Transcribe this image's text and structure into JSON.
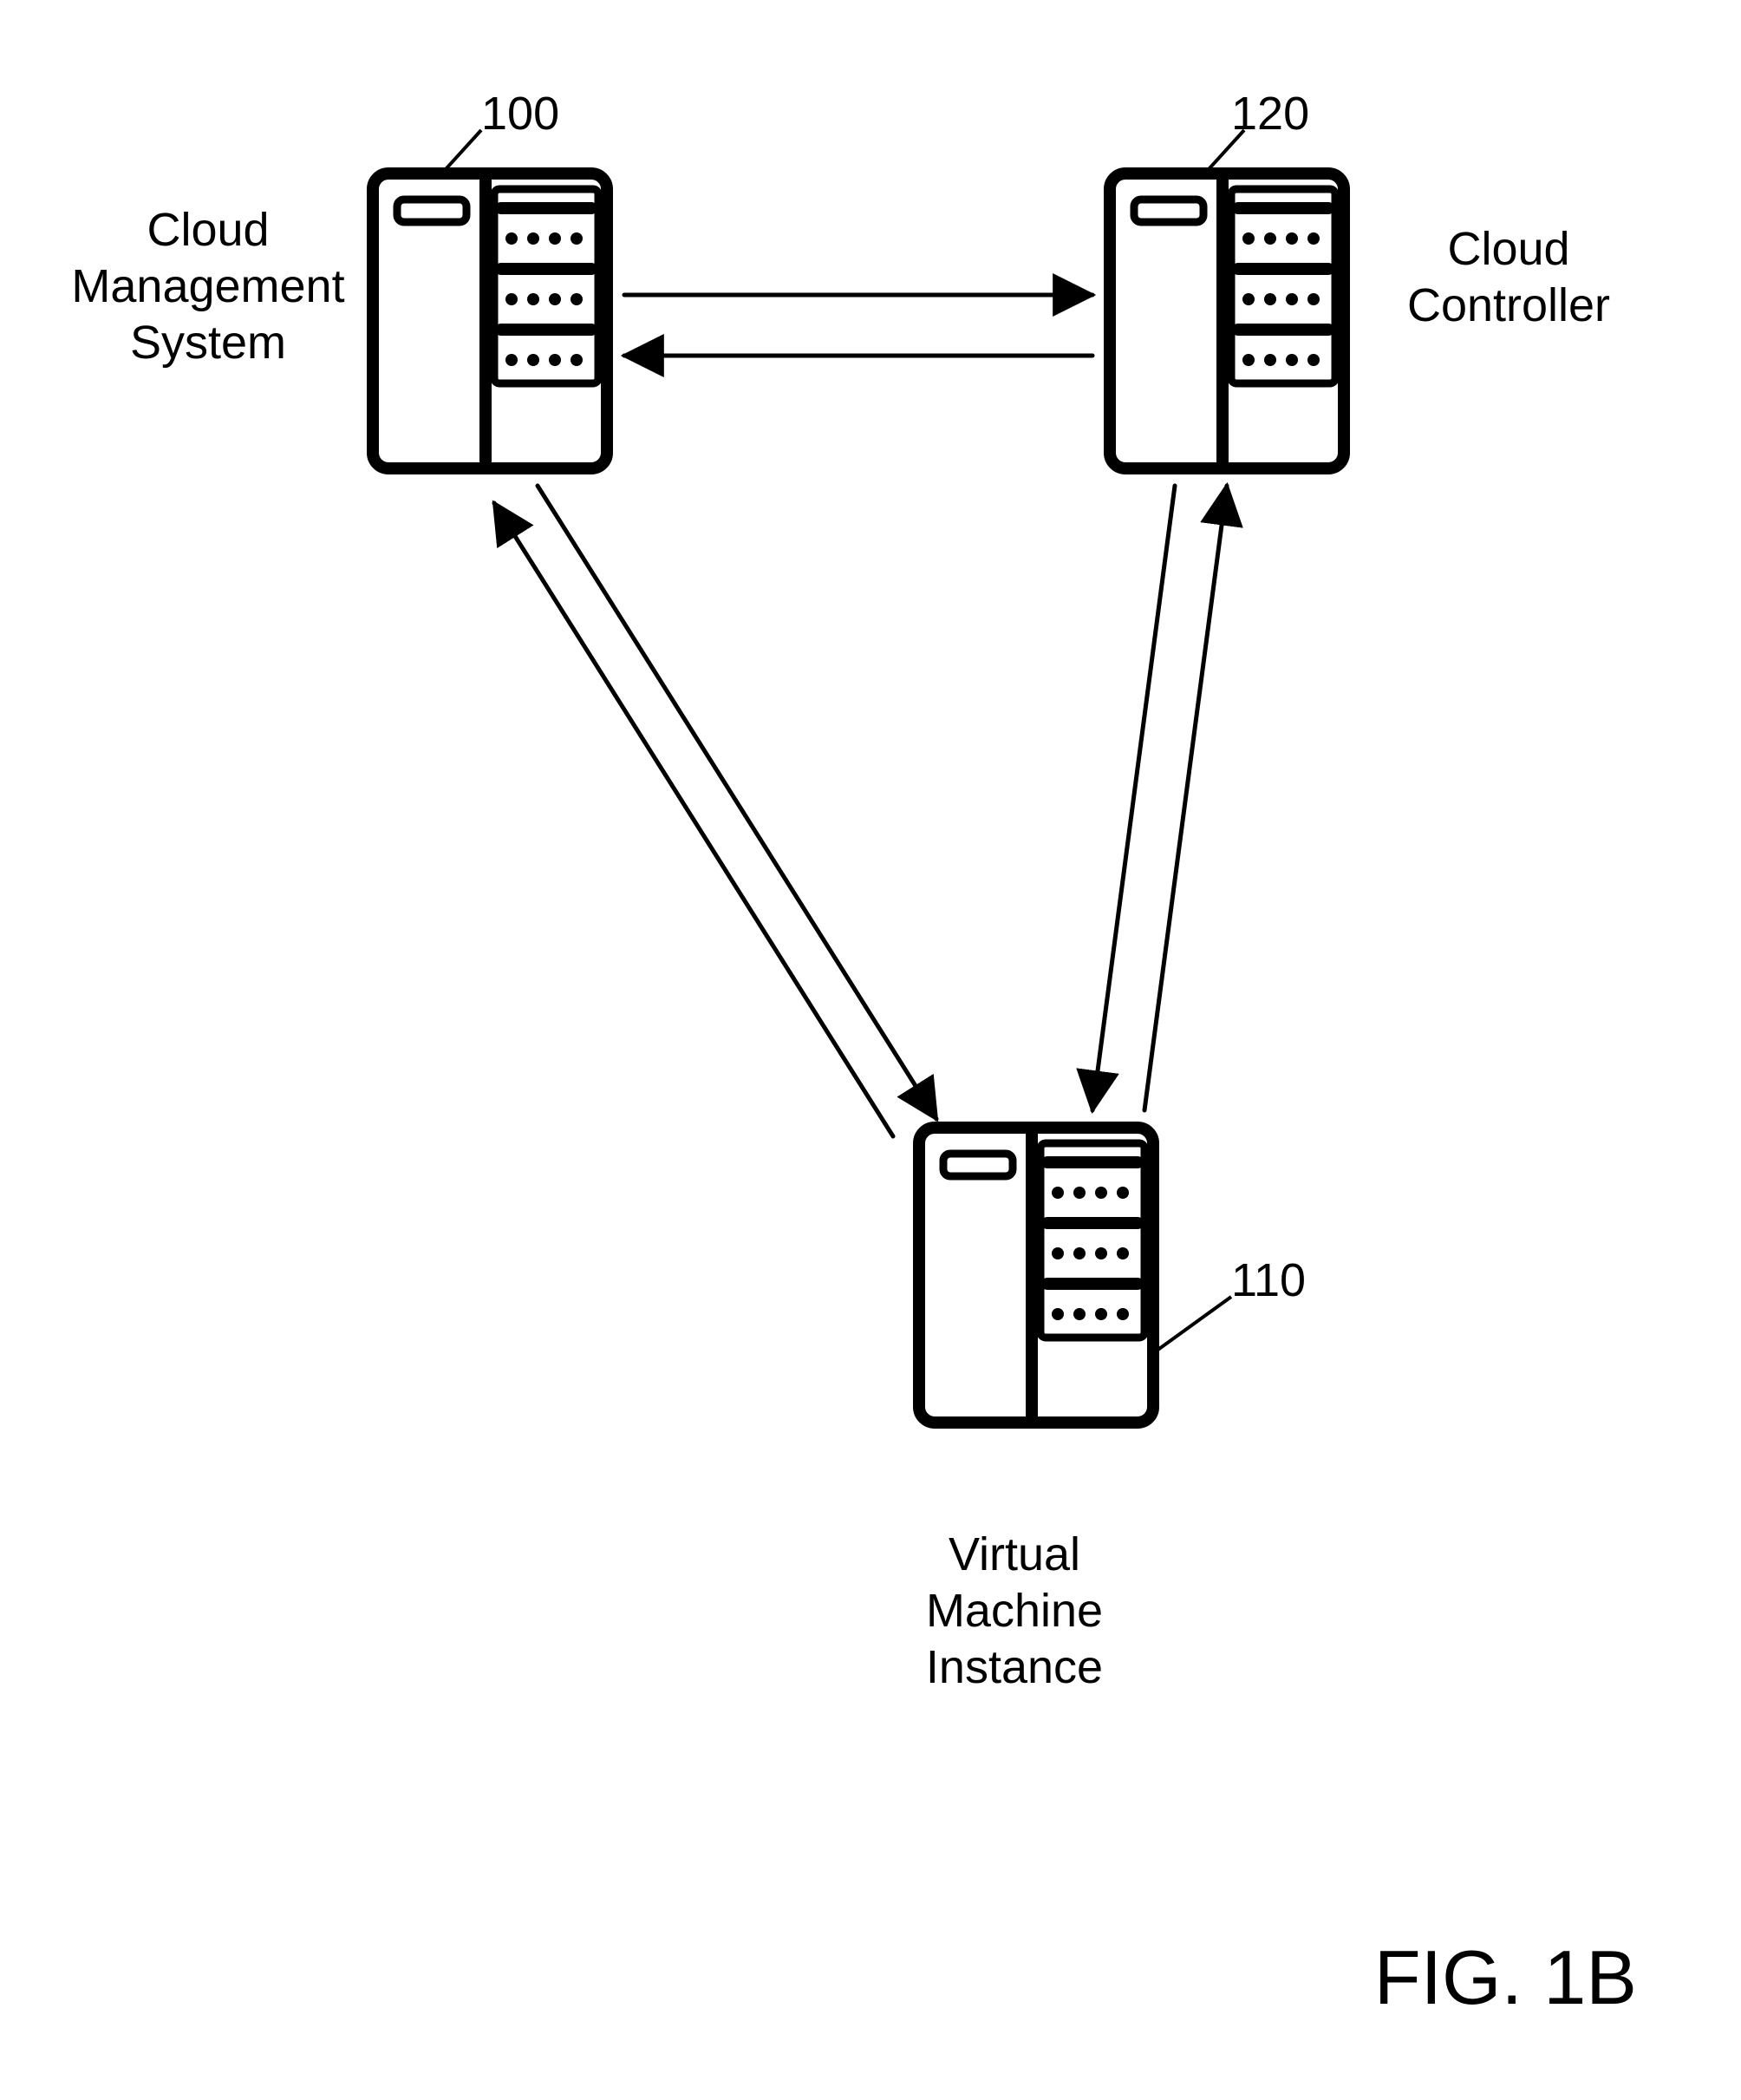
{
  "nodes": {
    "cms": {
      "ref": "100",
      "label": "Cloud\nManagement\nSystem"
    },
    "cc": {
      "ref": "120",
      "label": "Cloud\nController"
    },
    "vmi": {
      "ref": "110",
      "label": "Virtual\nMachine\nInstance"
    }
  },
  "figure_caption": "FIG. 1B",
  "connections": [
    {
      "from": "cms",
      "to": "cc",
      "bidirectional": true
    },
    {
      "from": "cc",
      "to": "vmi",
      "bidirectional": true
    },
    {
      "from": "cms",
      "to": "vmi",
      "bidirectional": true
    }
  ]
}
